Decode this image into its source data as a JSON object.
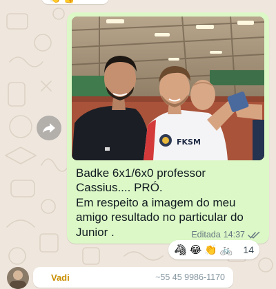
{
  "colors": {
    "wallpaper": "#efe7dd",
    "outgoing_bubble": "#dcf8c6",
    "read_ticks": "#667781",
    "sender_name": "#c98e00"
  },
  "previous_message": {
    "reactions": [
      "👏",
      "👍"
    ]
  },
  "forward_icon": "forward-arrow-icon",
  "message": {
    "text": "Badke 6x1/6x0 professor\nCassius.... PRÓ.\nEm respeito a imagem do meu amigo resultado no particular do Junior   .",
    "edited_label": "Editada",
    "time": "14:37",
    "status_icon": "double-check-icon",
    "photo": {
      "subject": "photo-two-men-tennis-court",
      "shirt_text": "FKSM"
    }
  },
  "reactions": {
    "emojis": [
      "🦓",
      "😂",
      "👏",
      "🚲"
    ],
    "count": "14"
  },
  "next_message": {
    "sender": "Vadi",
    "phone": "~55 45 9986-1170"
  }
}
